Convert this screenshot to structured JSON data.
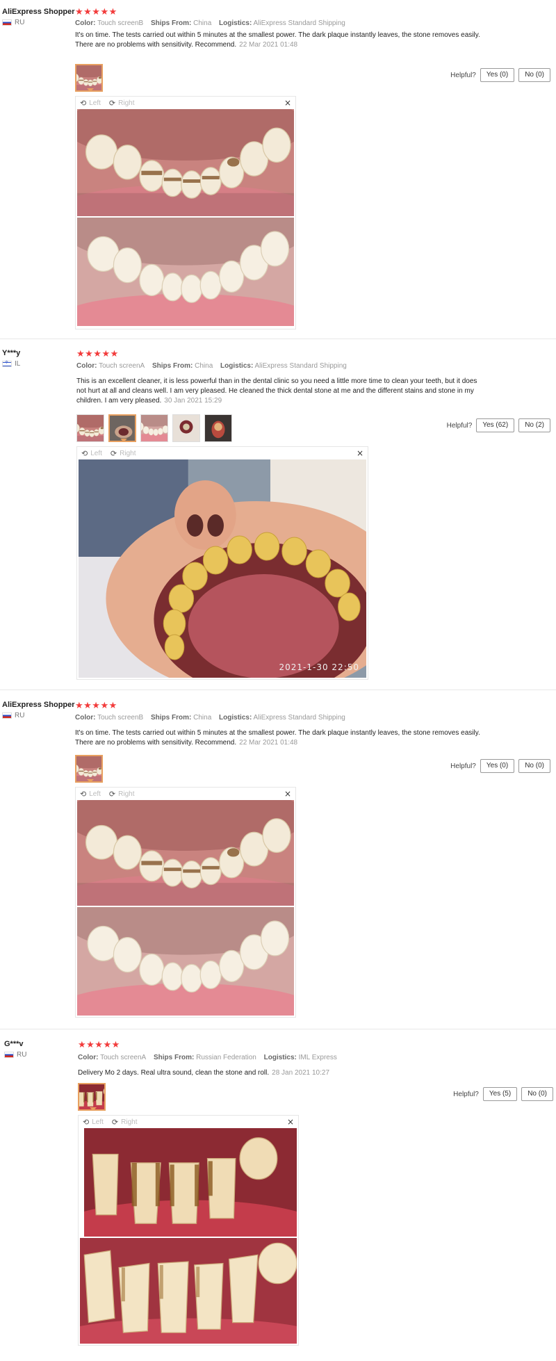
{
  "helpful_label": "Helpful?",
  "viewer": {
    "left_label": "Left",
    "right_label": "Right",
    "close_glyph": "×",
    "rotate_left_glyph": "⟲",
    "rotate_right_glyph": "⟳"
  },
  "labels": {
    "color": "Color:",
    "ships_from": "Ships From:",
    "logistics": "Logistics:"
  },
  "stars": "★★★★★",
  "colors": {
    "star": "#f23b3b",
    "active_thumb": "#e8a060"
  },
  "reviews": [
    {
      "user": "AliExpress Shopper",
      "country": "RU",
      "color": "Touch screenB",
      "ships_from": "China",
      "logistics": "AliExpress Standard Shipping",
      "text": "It's on time. The tests carried out within 5 minutes at the smallest power. The dark plaque instantly leaves, the stone removes easily. There are no problems with sensitivity. Recommend.",
      "date": "22 Mar 2021 01:48",
      "yes": "Yes (0)",
      "no": "No (0)"
    },
    {
      "user": "Y***y",
      "country": "IL",
      "color": "Touch screenA",
      "ships_from": "China",
      "logistics": "AliExpress Standard Shipping",
      "text": "This is an excellent cleaner, it is less powerful than in the dental clinic so you need a little more time to clean your teeth, but it does not hurt at all and cleans well. I am very pleased. He cleaned the thick dental stone at me and the different stains and stone in my children. I am very pleased.",
      "date": "30 Jan 2021 15:29",
      "yes": "Yes (62)",
      "no": "No (2)",
      "photo_stamp": "2021-1-30 22:50"
    },
    {
      "user": "AliExpress Shopper",
      "country": "RU",
      "color": "Touch screenB",
      "ships_from": "China",
      "logistics": "AliExpress Standard Shipping",
      "text": "It's on time. The tests carried out within 5 minutes at the smallest power. The dark plaque instantly leaves, the stone removes easily. There are no problems with sensitivity. Recommend.",
      "date": "22 Mar 2021 01:48",
      "yes": "Yes (0)",
      "no": "No (0)"
    },
    {
      "user": "G***v",
      "country": "RU",
      "color": "Touch screenA",
      "ships_from": "Russian Federation",
      "logistics": "IML Express",
      "text": "Delivery Mo 2 days. Real ultra sound, clean the stone and roll.",
      "date": "28 Jan 2021 10:27",
      "yes": "Yes (5)",
      "no": "No (0)"
    }
  ]
}
